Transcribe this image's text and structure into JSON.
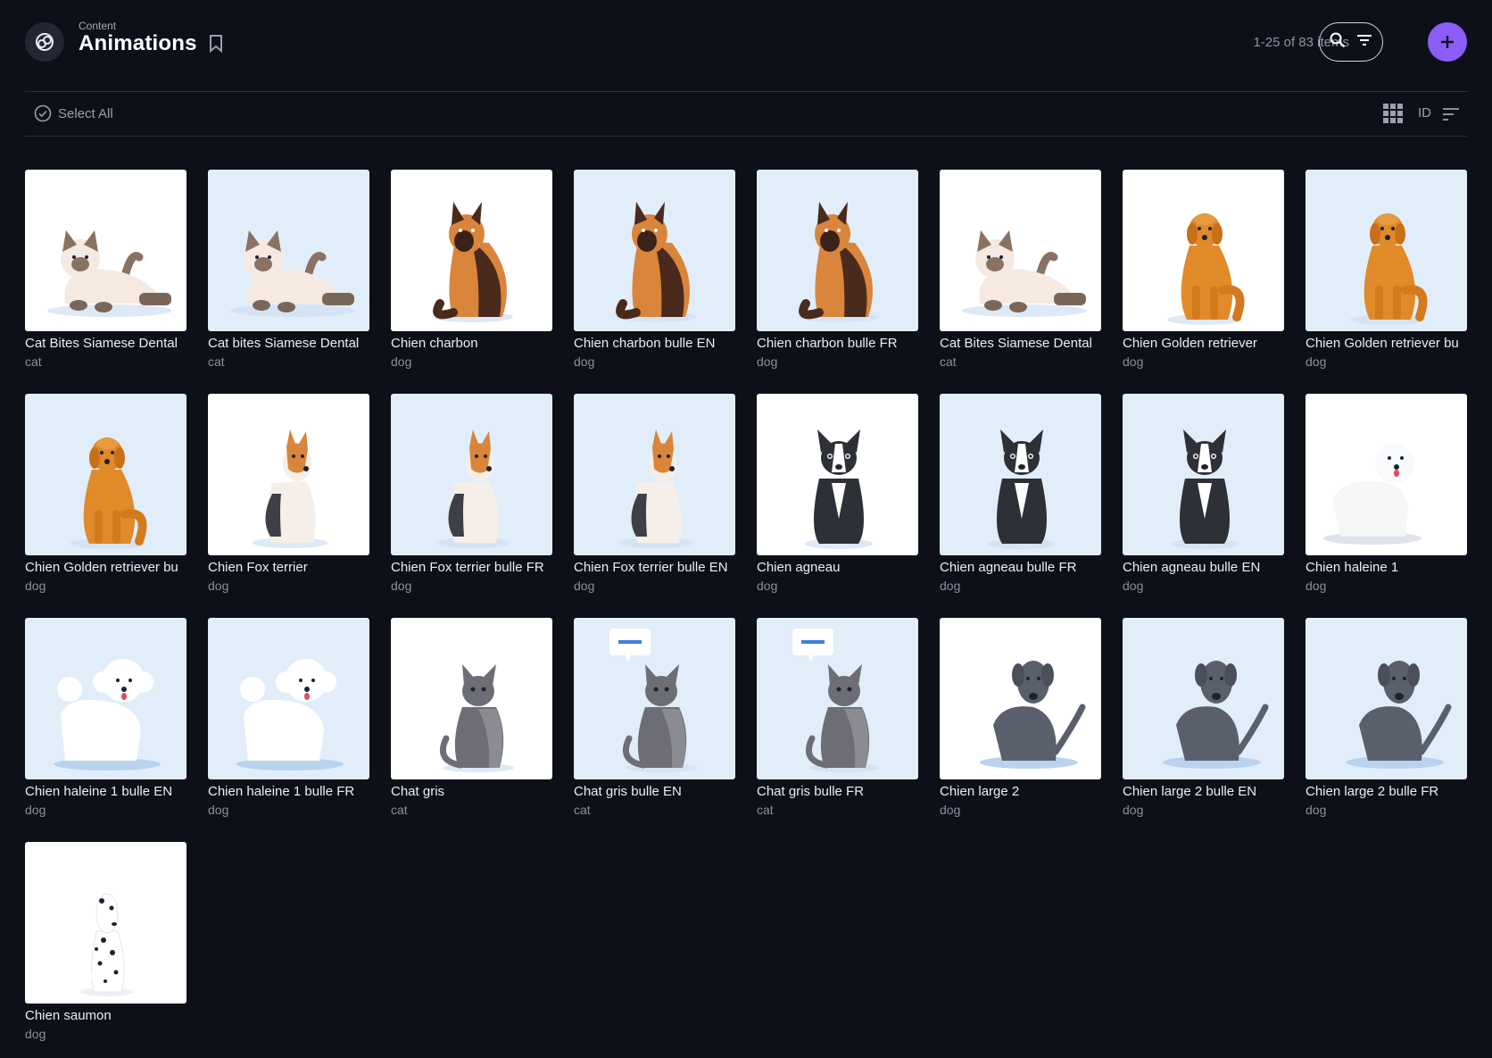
{
  "header": {
    "breadcrumb": "Content",
    "title": "Animations",
    "app_icon": "animation-rings-icon",
    "bookmark_icon": "bookmark-icon",
    "item_count": "1-25 of 83 items",
    "search_icon": "search-icon",
    "filter_icon": "filter-icon",
    "add_icon": "plus-icon",
    "accent_color": "#8b5cf6"
  },
  "toolbar": {
    "select_all": "Select All",
    "view_icon": "grid-view-icon",
    "sort_field": "ID",
    "sort_icon": "sort-icon"
  },
  "items": [
    {
      "name": "Cat Bites Siamese Dental",
      "category": "cat",
      "art": "siamese",
      "bg": "white"
    },
    {
      "name": "Cat bites Siamese Dental",
      "category": "cat",
      "art": "siamese",
      "bg": "blue"
    },
    {
      "name": "Chien charbon",
      "category": "dog",
      "art": "shepherd",
      "bg": "white"
    },
    {
      "name": "Chien charbon bulle EN",
      "category": "dog",
      "art": "shepherd",
      "bg": "blue"
    },
    {
      "name": "Chien charbon bulle FR",
      "category": "dog",
      "art": "shepherd",
      "bg": "blue"
    },
    {
      "name": "Cat Bites Siamese Dental",
      "category": "cat",
      "art": "siamese",
      "bg": "white"
    },
    {
      "name": "Chien Golden retriever",
      "category": "dog",
      "art": "golden",
      "bg": "white"
    },
    {
      "name": "Chien Golden retriever bu",
      "category": "dog",
      "art": "golden",
      "bg": "blue"
    },
    {
      "name": "Chien Golden retriever bu",
      "category": "dog",
      "art": "golden",
      "bg": "blue"
    },
    {
      "name": "Chien Fox terrier",
      "category": "dog",
      "art": "fox",
      "bg": "white"
    },
    {
      "name": "Chien Fox terrier bulle FR",
      "category": "dog",
      "art": "fox",
      "bg": "blue"
    },
    {
      "name": "Chien Fox terrier bulle EN",
      "category": "dog",
      "art": "fox",
      "bg": "blue"
    },
    {
      "name": "Chien agneau",
      "category": "dog",
      "art": "boston",
      "bg": "white"
    },
    {
      "name": "Chien agneau bulle FR",
      "category": "dog",
      "art": "boston",
      "bg": "blue"
    },
    {
      "name": "Chien agneau bulle EN",
      "category": "dog",
      "art": "boston",
      "bg": "blue"
    },
    {
      "name": "Chien haleine 1",
      "category": "dog",
      "art": "westie",
      "bg": "white"
    },
    {
      "name": "Chien haleine 1 bulle EN",
      "category": "dog",
      "art": "poodle",
      "bg": "blue"
    },
    {
      "name": "Chien haleine 1 bulle FR",
      "category": "dog",
      "art": "poodle",
      "bg": "blue"
    },
    {
      "name": "Chat gris",
      "category": "cat",
      "art": "graycat",
      "bg": "white"
    },
    {
      "name": "Chat gris bulle EN",
      "category": "cat",
      "art": "graycat-bubble",
      "bg": "blue"
    },
    {
      "name": "Chat gris bulle FR",
      "category": "cat",
      "art": "graycat-bubble",
      "bg": "blue"
    },
    {
      "name": "Chien large 2",
      "category": "dog",
      "art": "dane",
      "bg": "white"
    },
    {
      "name": "Chien large 2 bulle EN",
      "category": "dog",
      "art": "dane",
      "bg": "blue"
    },
    {
      "name": "Chien large 2 bulle FR",
      "category": "dog",
      "art": "dane",
      "bg": "blue"
    },
    {
      "name": "Chien saumon",
      "category": "dog",
      "art": "dalmatian",
      "bg": "white"
    }
  ]
}
